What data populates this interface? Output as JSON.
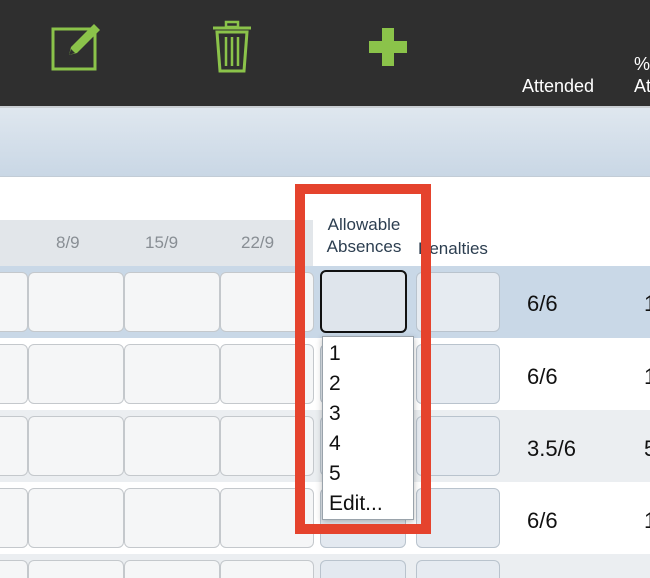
{
  "toolbar": {
    "edit_icon": "edit-icon",
    "delete_icon": "trash-icon",
    "add_icon": "plus-icon",
    "attended_label": "Attended",
    "pct_label_line1": "%",
    "pct_label_line2": "At",
    "icon_color": "#8bc34a"
  },
  "table": {
    "date_headers": [
      "8/9",
      "15/9",
      "22/9"
    ],
    "allowable_header_line1": "Allowable",
    "allowable_header_line2": "Absences",
    "penalties_header": "Penalties",
    "rows": [
      {
        "attended": "6/6",
        "pct": "1"
      },
      {
        "attended": "6/6",
        "pct": "1"
      },
      {
        "attended": "3.5/6",
        "pct": "5"
      },
      {
        "attended": "6/6",
        "pct": "1"
      }
    ]
  },
  "dropdown": {
    "options": [
      "1",
      "2",
      "3",
      "4",
      "5",
      "Edit..."
    ]
  },
  "colors": {
    "toolbar_bg": "#2f2f2f",
    "highlight": "#e5432d",
    "selected_row": "#c9d8e7",
    "alt_row": "#ebeef1"
  }
}
